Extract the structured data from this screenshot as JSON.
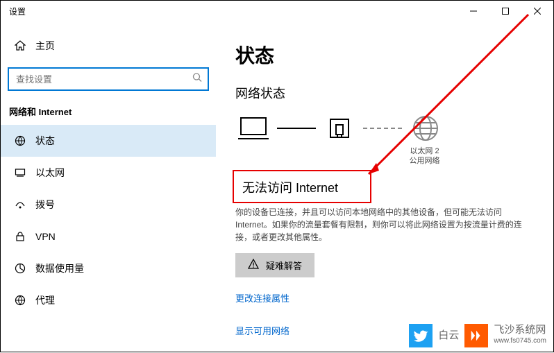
{
  "titlebar": {
    "title": "设置"
  },
  "sidebar": {
    "home_label": "主页",
    "search_placeholder": "查找设置",
    "category": "网络和 Internet",
    "items": [
      {
        "label": "状态"
      },
      {
        "label": "以太网"
      },
      {
        "label": "拨号"
      },
      {
        "label": "VPN"
      },
      {
        "label": "数据使用量"
      },
      {
        "label": "代理"
      }
    ]
  },
  "main": {
    "title": "状态",
    "section": "网络状态",
    "adapter_line1": "以太网 2",
    "adapter_line2": "公用网络",
    "no_internet": "无法访问 Internet",
    "description": "你的设备已连接，并且可以访问本地网络中的其他设备，但可能无法访问 Internet。如果你的流量套餐有限制，则你可以将此网络设置为按流量计费的连接，或者更改其他属性。",
    "troubleshoot": "疑难解答",
    "link_change": "更改连接属性",
    "link_available": "显示可用网络"
  },
  "watermark": {
    "baiyun": "白云",
    "feisha": "飞沙系统网",
    "url": "www.fs0745.com"
  }
}
